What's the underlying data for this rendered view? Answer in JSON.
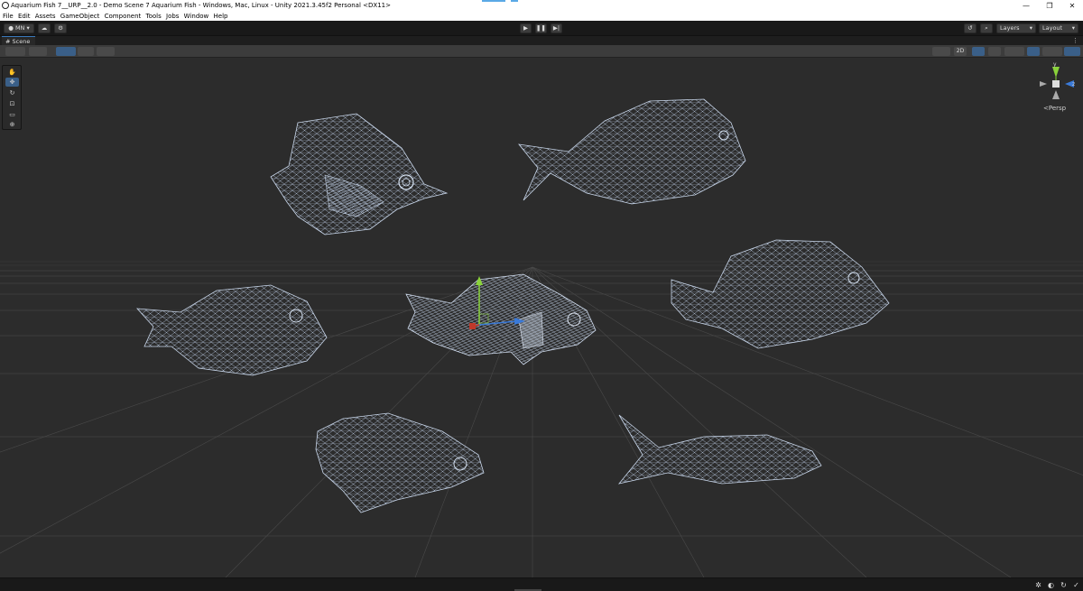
{
  "window": {
    "title": "Aquarium Fish 7__URP__2.0 - Demo Scene 7 Aquarium Fish - Windows, Mac, Linux - Unity 2021.3.45f2 Personal <DX11>"
  },
  "menu": [
    "File",
    "Edit",
    "Assets",
    "GameObject",
    "Component",
    "Tools",
    "Jobs",
    "Window",
    "Help"
  ],
  "toolbar": {
    "account_label": "MN",
    "layers_label": "Layers",
    "layout_label": "Layout"
  },
  "scene_tab": {
    "label": "Scene"
  },
  "scene_toolbar": {
    "mode_2d_label": "2D"
  },
  "gizmo": {
    "projection_label": "Persp",
    "y_axis": "y",
    "z_axis": "z"
  },
  "icons": {
    "play": "play-icon",
    "pause": "pause-icon",
    "step": "step-icon",
    "history": "history-icon",
    "search": "search-icon",
    "cloud": "cloud-icon"
  },
  "colors": {
    "accent": "#3a5f88",
    "axis_x": "#c0392b",
    "axis_y": "#8ad33a",
    "axis_z": "#3a7ad9",
    "wire": "#b8c8e0"
  }
}
